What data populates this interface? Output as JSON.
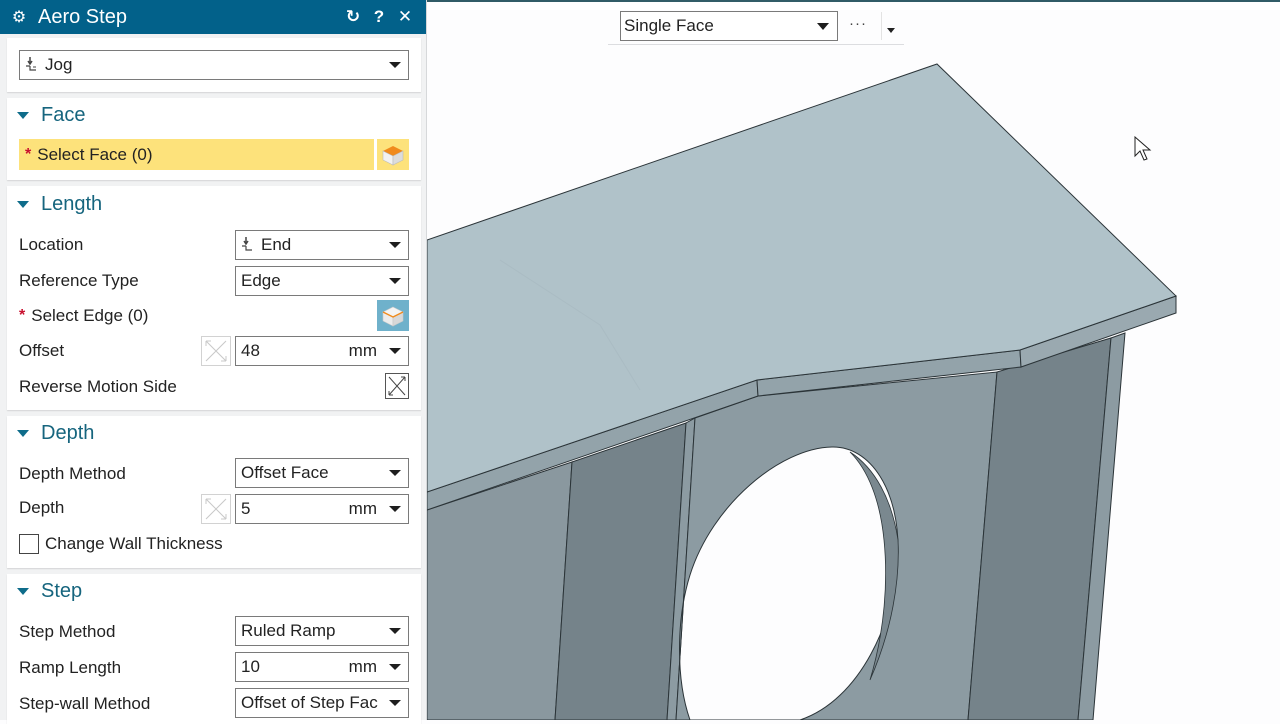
{
  "dialog": {
    "title": "Aero Step",
    "title_icons": [
      "gear-icon",
      "reset-icon",
      "help-icon",
      "close-icon"
    ],
    "reset_glyph": "↻",
    "help_glyph": "?",
    "close_glyph": "✕",
    "type_select": {
      "value": "Jog",
      "icon": "jog-icon"
    },
    "groups": {
      "face": {
        "title": "Face",
        "select_face": {
          "label": "Select Face (0)",
          "required_mark": "*",
          "icon": "face-select-icon",
          "highlight_color": "#fde27b"
        }
      },
      "length": {
        "title": "Length",
        "location": {
          "label": "Location",
          "value": "End",
          "icon": "jog-icon"
        },
        "reference_type": {
          "label": "Reference Type",
          "value": "Edge"
        },
        "select_edge": {
          "label": "Select Edge (0)",
          "required_mark": "*",
          "icon": "edge-select-icon"
        },
        "offset": {
          "label": "Offset",
          "value": "48",
          "unit": "mm"
        },
        "reverse_motion_side": {
          "label": "Reverse Motion Side",
          "icon": "reverse-direction-icon"
        }
      },
      "depth": {
        "title": "Depth",
        "depth_method": {
          "label": "Depth Method",
          "value": "Offset Face"
        },
        "depth": {
          "label": "Depth",
          "value": "5",
          "unit": "mm"
        },
        "change_wall_thickness": {
          "label": "Change Wall Thickness",
          "checked": false
        }
      },
      "step": {
        "title": "Step",
        "step_method": {
          "label": "Step Method",
          "value": "Ruled Ramp"
        },
        "ramp_length": {
          "label": "Ramp Length",
          "value": "10",
          "unit": "mm"
        },
        "step_wall_method": {
          "label": "Step-wall Method",
          "value": "Offset of Step Fac"
        }
      }
    }
  },
  "viewport": {
    "selection_filter": {
      "value": "Single Face"
    },
    "more_label": "···",
    "model_colors": {
      "top": "#b0c2c9",
      "side_light": "#8c9ba2",
      "side_dark": "#75838a",
      "edge": "#2b3438"
    }
  },
  "colors": {
    "title_bar": "#02618a",
    "group_title": "#16657e",
    "required": "#c8102e"
  }
}
